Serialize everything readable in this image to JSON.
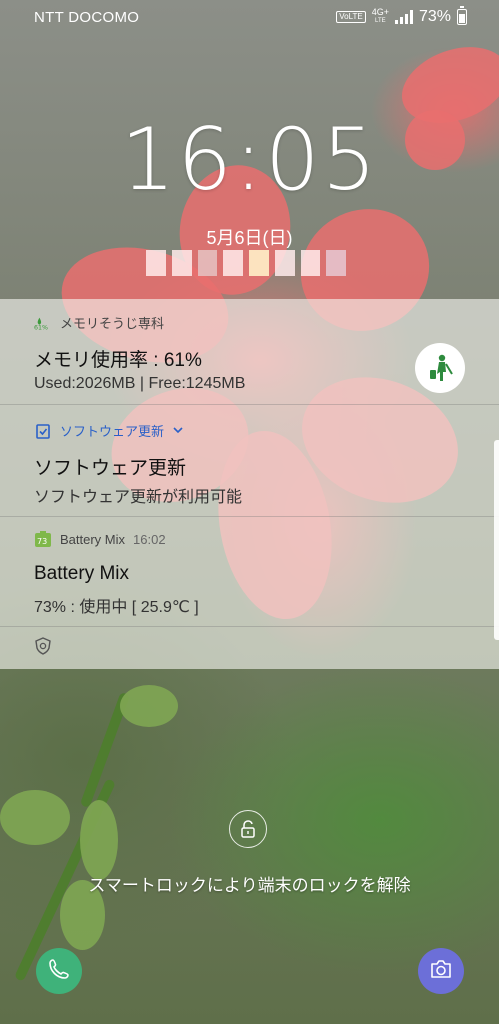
{
  "status_bar": {
    "carrier": "NTT DOCOMO",
    "volte": "VoLTE",
    "network": "4G+",
    "network_sub": "LTE",
    "battery": "73%"
  },
  "lockscreen": {
    "time": "16:05",
    "date": "5月6日(日)",
    "unlock_hint": "スマートロックにより端末のロックを解除"
  },
  "notifications": [
    {
      "app": "メモリそうじ専科",
      "app_badge": "61%",
      "title": "メモリ使用率 : 61%",
      "body": "Used:2026MB | Free:1245MB",
      "icon": "cleaner-icon"
    },
    {
      "app": "ソフトウェア更新",
      "title": "ソフトウェア更新",
      "body": "ソフトウェア更新が利用可能",
      "icon": "update-icon"
    },
    {
      "app": "Battery Mix",
      "app_badge": "73",
      "time": "16:02",
      "title": "Battery Mix",
      "body": "73% : 使用中 [ 25.9℃ ]",
      "icon": "battery-mix-icon"
    },
    {
      "icon": "shield-icon"
    }
  ],
  "colors": {
    "accent_blue": "#2a60c8",
    "phone": "#3fb27a",
    "camera": "#6c6fd8"
  }
}
